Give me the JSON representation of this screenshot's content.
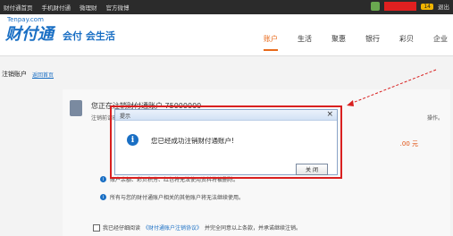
{
  "topbar": {
    "links": [
      "财付通首页",
      "手机财付通",
      "微理财",
      "官方微博"
    ],
    "right_badge": "14",
    "logout": "退出"
  },
  "brand": {
    "logo_small": "Tenpay.com",
    "logo": "财付通",
    "slogan": "会付 会生活"
  },
  "nav": [
    "账户",
    "生活",
    "聚惠",
    "银行",
    "彩贝",
    "企业"
  ],
  "crumb": {
    "title": "注销账户",
    "back": "返回首页"
  },
  "panel": {
    "line1": "您正在注销财付通账户 75000000",
    "line2": "注销前请确认",
    "line3": "操作。",
    "amount": ".00 元",
    "info1": "账户余额、彩贝积分、红包将无法使用资料将被删除。",
    "info2": "所有与您的财付通账户相关的其他账户将无法继续使用。",
    "agree": "我已经仔细阅读",
    "agree_link": "《财付通账户注销协议》",
    "agree_rest": "并完全同意以上条款，并承诺继续注销。"
  },
  "dialog": {
    "title": "提示",
    "message": "您已经成功注销财付通账户!",
    "button": "关 闭"
  }
}
